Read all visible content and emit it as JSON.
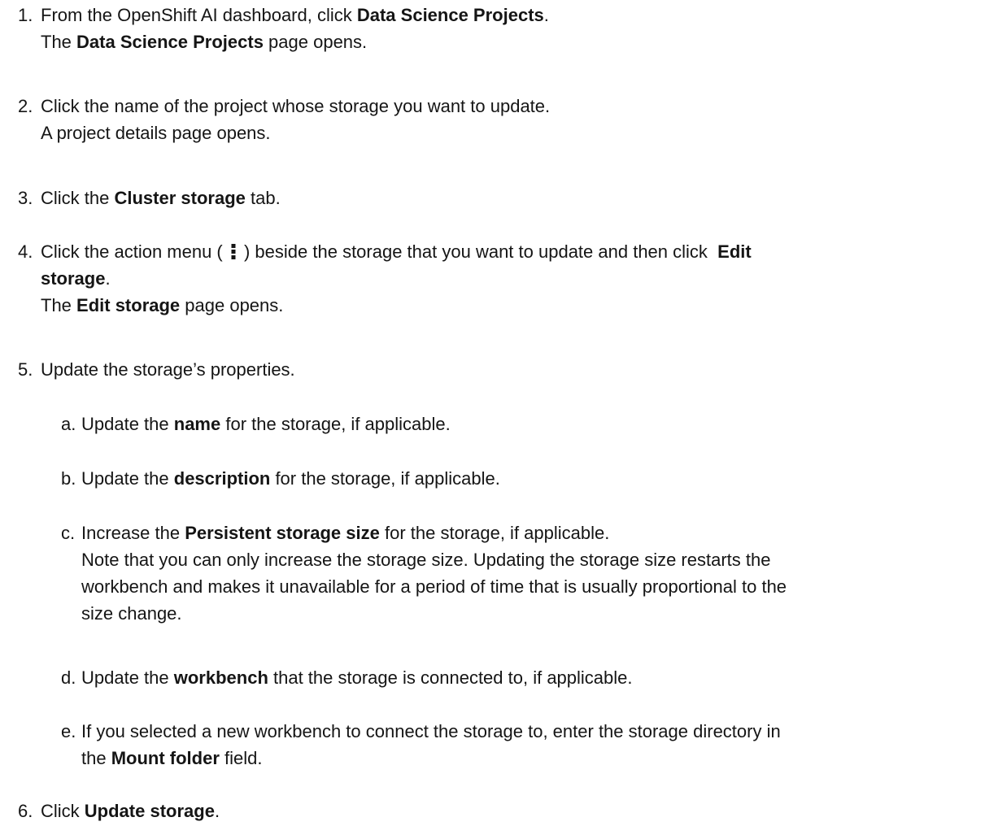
{
  "steps": [
    {
      "num": "1.",
      "lines": [
        [
          {
            "t": "From the OpenShift AI dashboard, click "
          },
          {
            "t": "Data Science Projects",
            "b": true
          },
          {
            "t": "."
          }
        ],
        [
          {
            "t": "The "
          },
          {
            "t": "Data Science Projects",
            "b": true
          },
          {
            "t": " page opens."
          }
        ]
      ]
    },
    {
      "num": "2.",
      "lines": [
        [
          {
            "t": "Click the name of the project whose storage you want to update."
          }
        ],
        [
          {
            "t": "A project details page opens."
          }
        ]
      ]
    },
    {
      "num": "3.",
      "lines": [
        [
          {
            "t": "Click the "
          },
          {
            "t": "Cluster storage",
            "b": true
          },
          {
            "t": " tab."
          }
        ]
      ]
    },
    {
      "num": "4.",
      "lines": [
        [
          {
            "t": "Click the action menu ( "
          },
          {
            "icon": "kebab-menu-icon"
          },
          {
            "t": " ) beside the storage that you want to update and then click  "
          },
          {
            "t": "Edit",
            "b": true
          }
        ],
        [
          {
            "t": "storage",
            "b": true
          },
          {
            "t": "."
          }
        ],
        [
          {
            "t": "The "
          },
          {
            "t": "Edit storage",
            "b": true
          },
          {
            "t": " page opens."
          }
        ]
      ]
    },
    {
      "num": "5.",
      "lines": [
        [
          {
            "t": "Update the storage’s properties."
          }
        ]
      ],
      "substeps": [
        {
          "num": "a.",
          "lines": [
            [
              {
                "t": "Update the "
              },
              {
                "t": "name",
                "b": true
              },
              {
                "t": " for the storage, if applicable."
              }
            ]
          ]
        },
        {
          "num": "b.",
          "lines": [
            [
              {
                "t": "Update the "
              },
              {
                "t": "description",
                "b": true
              },
              {
                "t": " for the storage, if applicable."
              }
            ]
          ]
        },
        {
          "num": "c.",
          "lines": [
            [
              {
                "t": "Increase the "
              },
              {
                "t": "Persistent storage size",
                "b": true
              },
              {
                "t": " for the storage, if applicable."
              }
            ],
            [
              {
                "t": "Note that you can only increase the storage size. Updating the storage size restarts the"
              }
            ],
            [
              {
                "t": "workbench and makes it unavailable for a period of time that is usually proportional to the"
              }
            ],
            [
              {
                "t": "size change."
              }
            ]
          ]
        },
        {
          "num": "d.",
          "lines": [
            [
              {
                "t": "Update the "
              },
              {
                "t": "workbench",
                "b": true
              },
              {
                "t": " that the storage is connected to, if applicable."
              }
            ]
          ]
        },
        {
          "num": "e.",
          "lines": [
            [
              {
                "t": "If you selected a new workbench to connect the storage to, enter the storage directory in"
              }
            ],
            [
              {
                "t": "the "
              },
              {
                "t": "Mount folder",
                "b": true
              },
              {
                "t": " field."
              }
            ]
          ]
        }
      ]
    },
    {
      "num": "6.",
      "lines": [
        [
          {
            "t": "Click "
          },
          {
            "t": "Update storage",
            "b": true
          },
          {
            "t": "."
          }
        ]
      ]
    }
  ]
}
